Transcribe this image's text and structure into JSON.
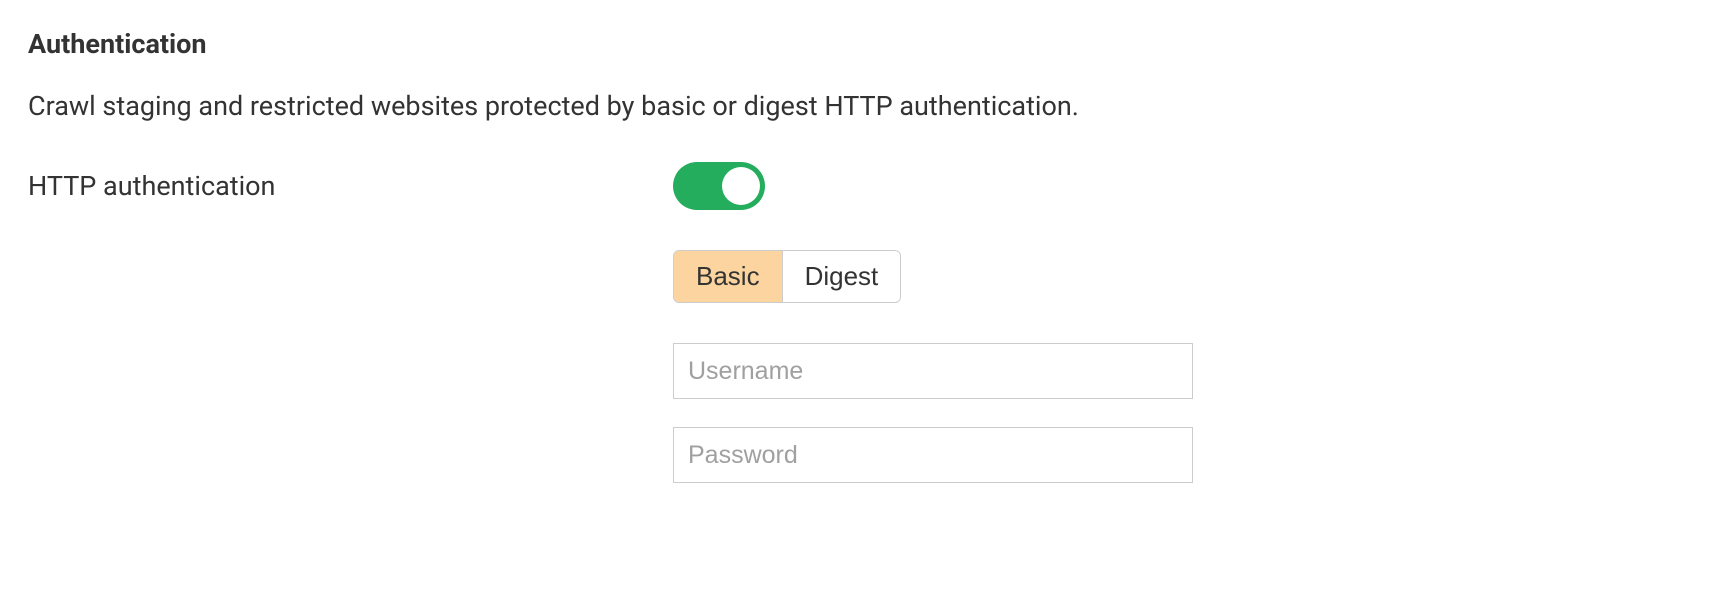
{
  "section": {
    "title": "Authentication",
    "description": "Crawl staging and restricted websites protected by basic or digest HTTP authentication.",
    "toggle_label": "HTTP authentication",
    "toggle_on": true,
    "auth_type": {
      "options": [
        "Basic",
        "Digest"
      ],
      "selected": "Basic"
    },
    "username": {
      "value": "",
      "placeholder": "Username"
    },
    "password": {
      "value": "",
      "placeholder": "Password"
    }
  }
}
